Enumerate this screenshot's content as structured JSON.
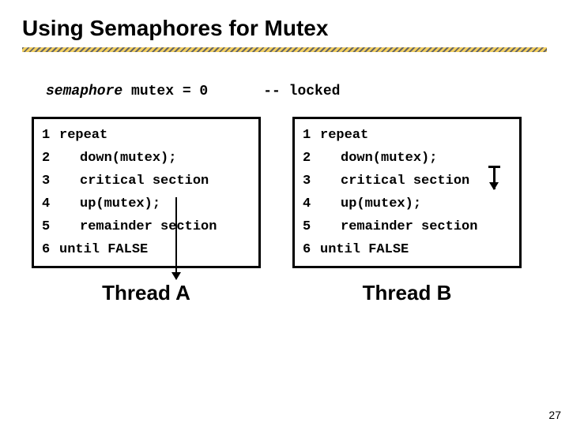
{
  "title": "Using Semaphores for Mutex",
  "decl": {
    "sema": "semaphore",
    "rest": " mutex = 0",
    "comment": "-- locked"
  },
  "box_a": {
    "lines": [
      {
        "n": "1",
        "indent": false,
        "text": "repeat"
      },
      {
        "n": "2",
        "indent": true,
        "text": "down(mutex);"
      },
      {
        "n": "3",
        "indent": true,
        "text": "critical section"
      },
      {
        "n": "4",
        "indent": true,
        "text": "up(mutex);"
      },
      {
        "n": "5",
        "indent": true,
        "text": "remainder section"
      },
      {
        "n": "6",
        "indent": false,
        "text": "until FALSE"
      }
    ],
    "label": "Thread A"
  },
  "box_b": {
    "lines": [
      {
        "n": "1",
        "indent": false,
        "text": "repeat"
      },
      {
        "n": "2",
        "indent": true,
        "text": "down(mutex);"
      },
      {
        "n": "3",
        "indent": true,
        "text": "critical section"
      },
      {
        "n": "4",
        "indent": true,
        "text": "up(mutex);"
      },
      {
        "n": "5",
        "indent": true,
        "text": "remainder section"
      },
      {
        "n": "6",
        "indent": false,
        "text": "until FALSE"
      }
    ],
    "label": "Thread B"
  },
  "pagenum": "27"
}
